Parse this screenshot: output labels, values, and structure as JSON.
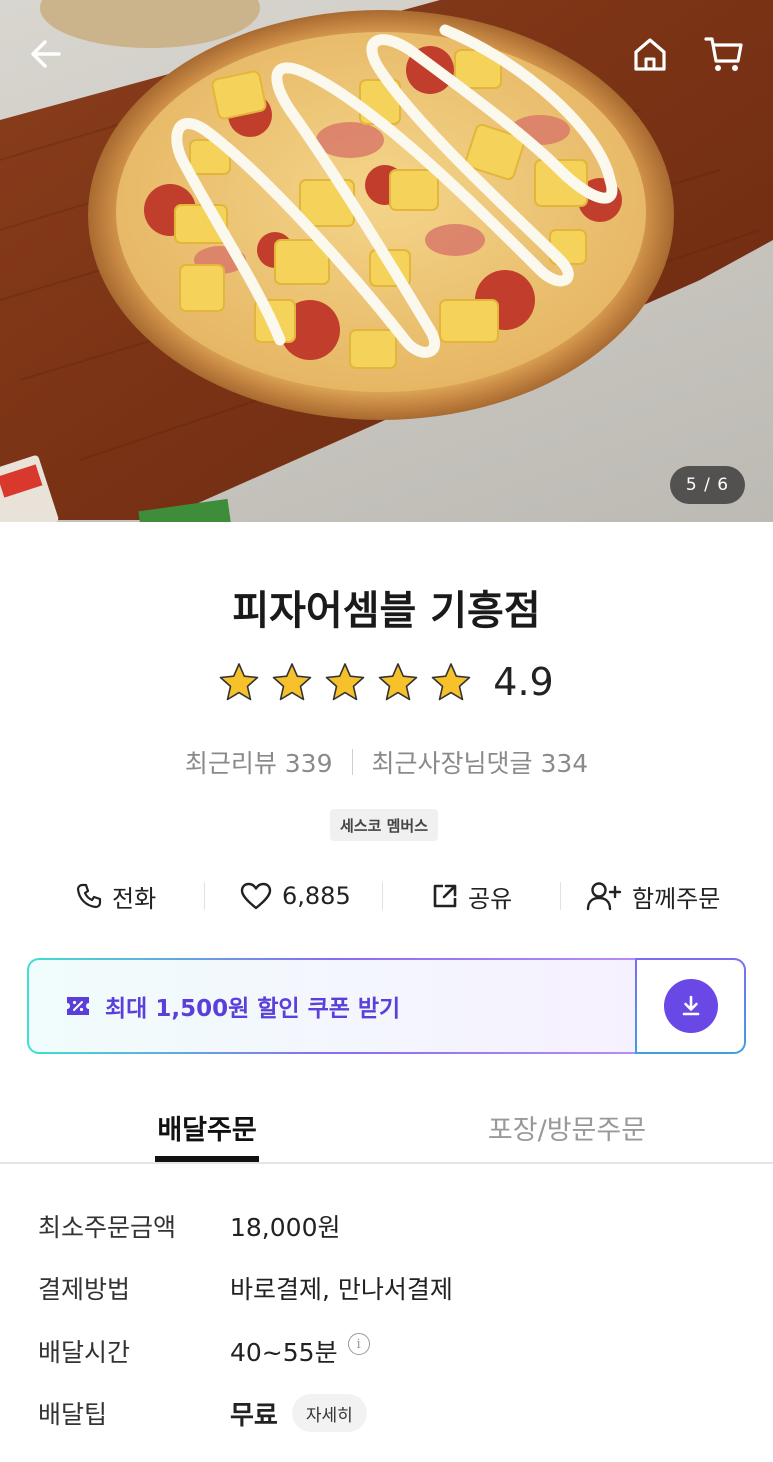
{
  "hero": {
    "pager": "5 / 6",
    "icons": [
      "back-arrow-icon",
      "home-icon",
      "cart-icon"
    ]
  },
  "store": {
    "name": "피자어셈블 기흥점",
    "rating": "4.9",
    "stars_filled": 5,
    "star_color": "#f6c12b",
    "recent_reviews": "최근리뷰 339",
    "owner_replies": "최근사장님댓글 334",
    "badge": "세스코 멤버스"
  },
  "actions": {
    "call": "전화",
    "likes": "6,885",
    "share": "공유",
    "group_order": "함께주문"
  },
  "coupon": {
    "text": "최대 1,500원 할인 쿠폰 받기",
    "accent": "#6a48e6"
  },
  "tabs": {
    "delivery": "배달주문",
    "pickup": "포장/방문주문"
  },
  "info": {
    "min_order_label": "최소주문금액",
    "min_order_value": "18,000원",
    "payment_label": "결제방법",
    "payment_value": "바로결제, 만나서결제",
    "time_label": "배달시간",
    "time_value": "40~55분",
    "tip_label": "배달팁",
    "tip_value": "무료",
    "tip_detail": "자세히"
  }
}
